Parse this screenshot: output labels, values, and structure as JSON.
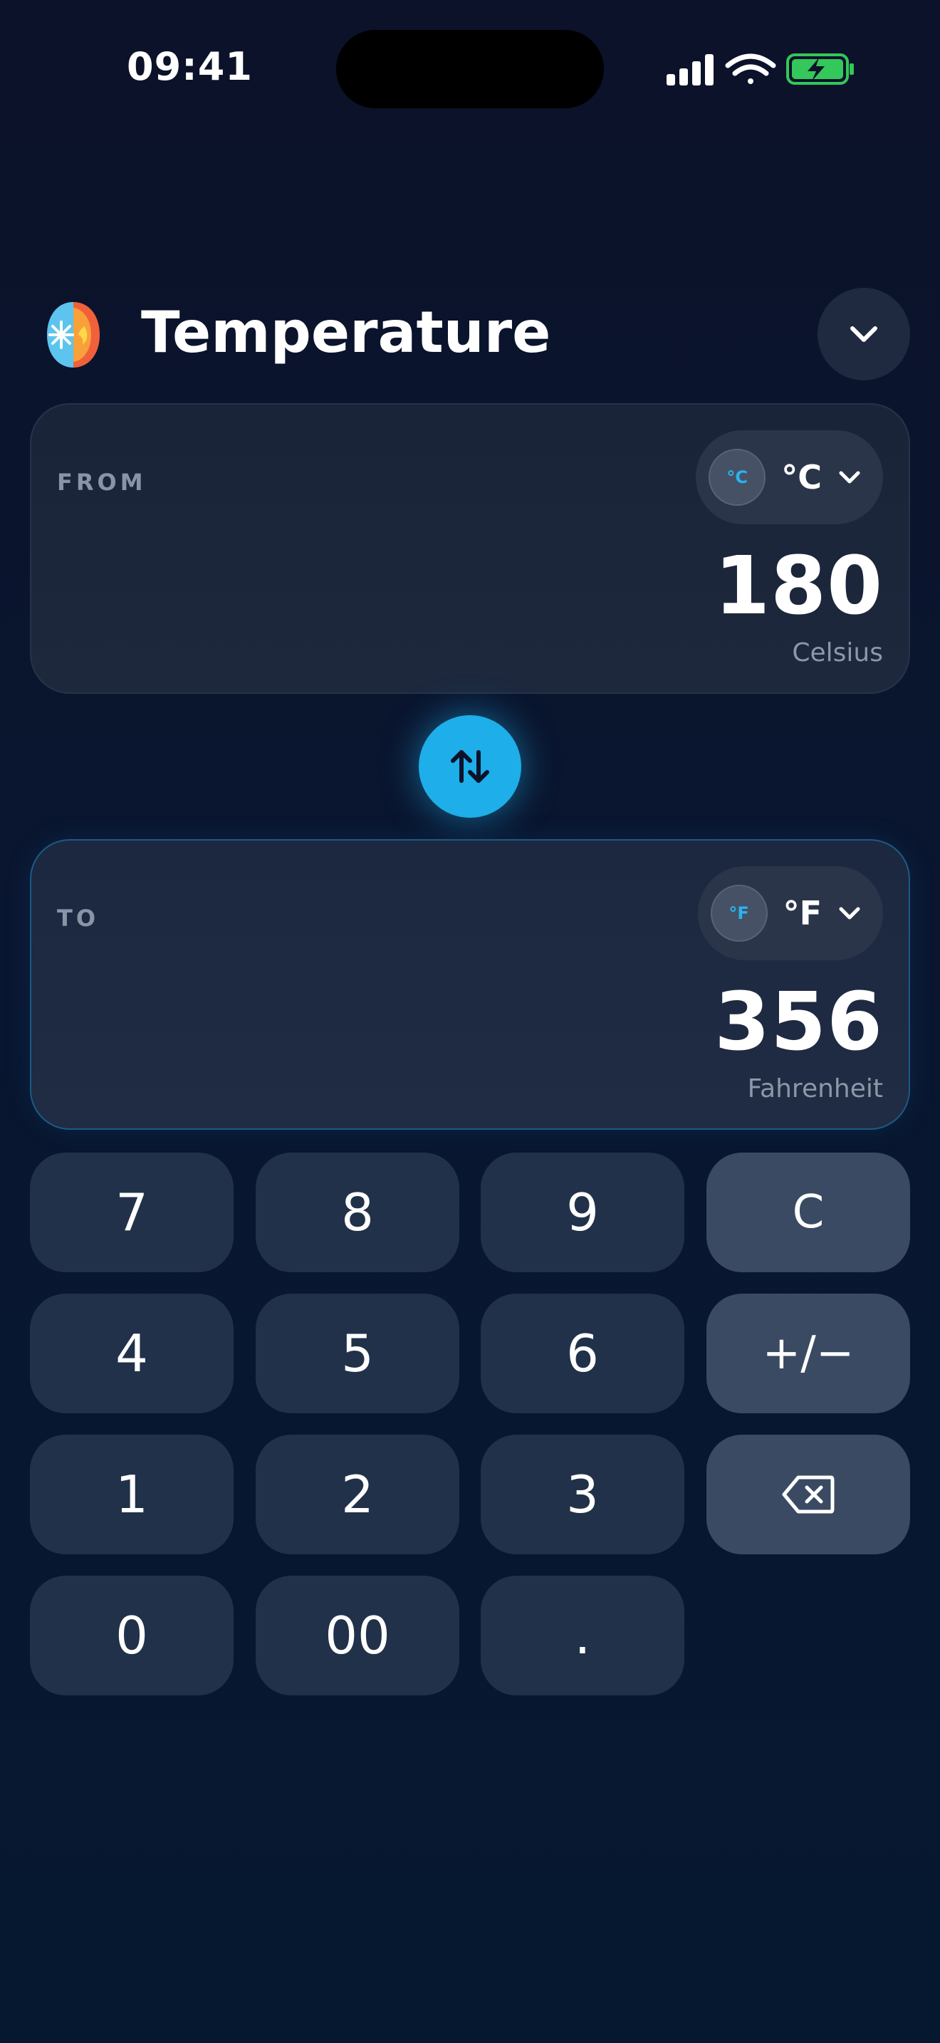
{
  "status_bar": {
    "time": "09:41"
  },
  "header": {
    "title": "Temperature",
    "logo_icon": "thermometer-hot-cold-icon",
    "menu_icon": "chevron-down-icon"
  },
  "from_card": {
    "label": "FROM",
    "unit_badge": "°C",
    "unit_symbol": "°C",
    "value": "180",
    "unit_name": "Celsius"
  },
  "to_card": {
    "label": "TO",
    "unit_badge": "°F",
    "unit_symbol": "°F",
    "value": "356",
    "unit_name": "Fahrenheit"
  },
  "swap": {
    "icon": "swap-vertical-icon"
  },
  "keypad": {
    "k7": "7",
    "k8": "8",
    "k9": "9",
    "clear": "C",
    "k4": "4",
    "k5": "5",
    "k6": "6",
    "sign": "+/−",
    "k1": "1",
    "k2": "2",
    "k3": "3",
    "backspace_icon": "backspace-icon",
    "k0": "0",
    "k00": "00",
    "dot": "."
  },
  "colors": {
    "background": "#0b1229",
    "accent": "#1eaee9",
    "key": "#22314a",
    "function_key": "#3a4a62",
    "battery": "#34c759"
  }
}
